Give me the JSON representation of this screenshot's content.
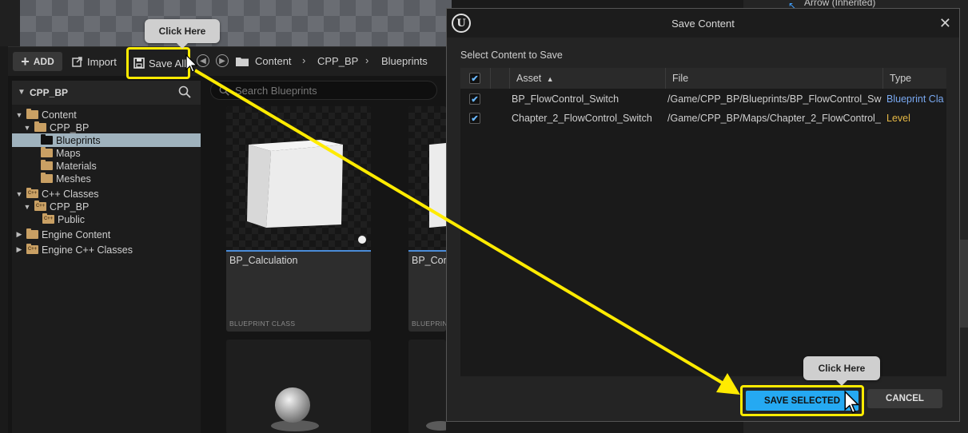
{
  "background": {
    "right_panel_item": "Arrow (Inherited)"
  },
  "content_browser": {
    "toolbar": {
      "add_label": "ADD",
      "import_label": "Import",
      "save_all_label": "Save All"
    },
    "breadcrumb": [
      "Content",
      "CPP_BP",
      "Blueprints"
    ],
    "tree": {
      "title": "CPP_BP",
      "items": [
        {
          "label": "Content"
        },
        {
          "label": "CPP_BP"
        },
        {
          "label": "Blueprints"
        },
        {
          "label": "Maps"
        },
        {
          "label": "Materials"
        },
        {
          "label": "Meshes"
        },
        {
          "label": "C++ Classes"
        },
        {
          "label": "CPP_BP"
        },
        {
          "label": "Public"
        },
        {
          "label": "Engine Content"
        },
        {
          "label": "Engine C++ Classes"
        }
      ]
    },
    "search": {
      "placeholder": "Search Blueprints"
    },
    "assets": [
      {
        "name": "BP_Calculation",
        "type": "BLUEPRINT CLASS"
      },
      {
        "name": "BP_Com",
        "type": "BLUEPRIN"
      }
    ],
    "cpp_badge": "C++"
  },
  "dialog": {
    "logo": "U",
    "title": "Save Content",
    "subtitle": "Select Content to Save",
    "columns": {
      "asset": "Asset",
      "sort_indicator": "▲",
      "file": "File",
      "type": "Type"
    },
    "rows": [
      {
        "asset": "BP_FlowControl_Switch",
        "file": "/Game/CPP_BP/Blueprints/BP_FlowControl_Sw",
        "type": "Blueprint Cla",
        "checked": true
      },
      {
        "asset": "Chapter_2_FlowControl_Switch",
        "file": "/Game/CPP_BP/Maps/Chapter_2_FlowControl_",
        "type": "Level",
        "checked": true
      }
    ],
    "save_selected_label": "SAVE SELECTED",
    "cancel_label": "CANCEL"
  },
  "annotations": {
    "callout_top": "Click Here",
    "callout_bottom": "Click Here",
    "highlight_color": "#ffeb00"
  },
  "colors": {
    "accent": "#25a9f2",
    "blueprint_type": "#79a8f0",
    "level_type": "#e5b845",
    "folder": "#c9a064"
  }
}
